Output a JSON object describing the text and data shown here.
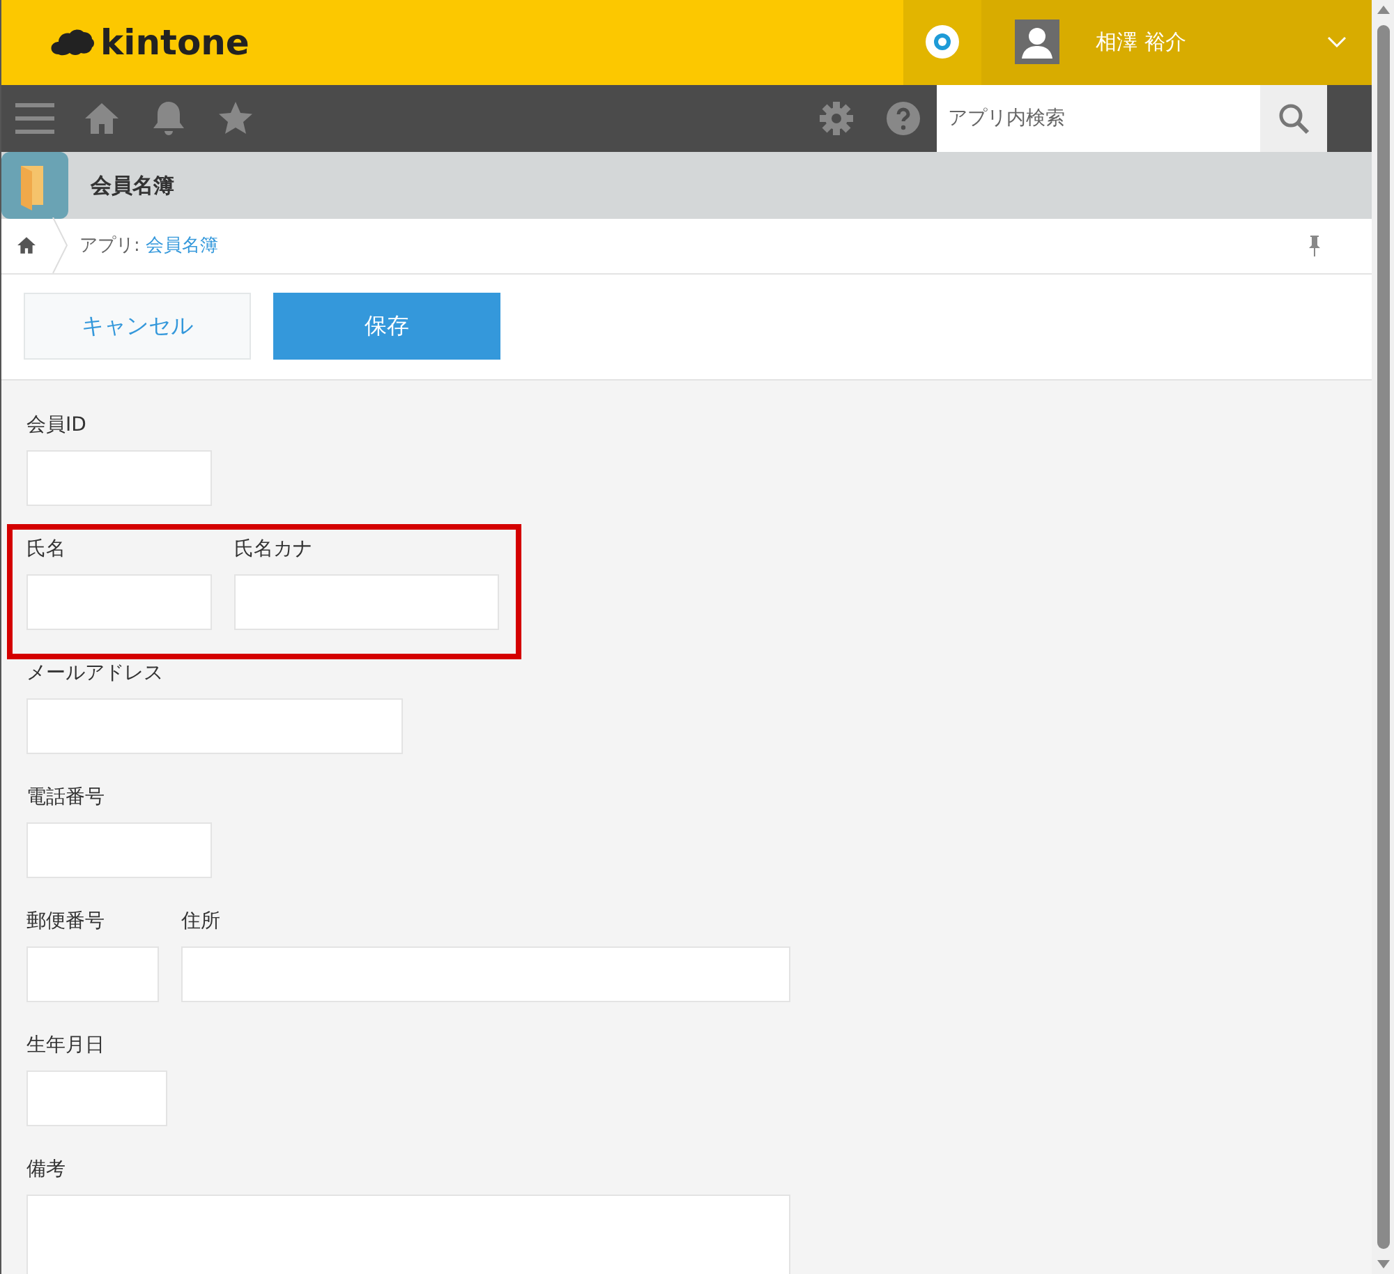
{
  "header": {
    "logo": "kintone",
    "user_name": "相澤 裕介"
  },
  "search": {
    "placeholder": "アプリ内検索"
  },
  "app": {
    "title": "会員名簿"
  },
  "breadcrumb": {
    "prefix": "アプリ:",
    "link": "会員名簿"
  },
  "buttons": [
    {
      "label": "キャンセル",
      "kind": "secondary"
    },
    {
      "label": "保存",
      "kind": "primary"
    }
  ],
  "form_rows": [
    {
      "highlighted": false,
      "fields": [
        {
          "label": "会員ID",
          "kind": "short"
        }
      ]
    },
    {
      "highlighted": true,
      "fields": [
        {
          "label": "氏名",
          "kind": "short"
        },
        {
          "label": "氏名カナ",
          "kind": "medium"
        }
      ]
    },
    {
      "highlighted": false,
      "fields": [
        {
          "label": "メールアドレス",
          "kind": "wide"
        }
      ]
    },
    {
      "highlighted": false,
      "fields": [
        {
          "label": "電話番号",
          "kind": "short"
        }
      ]
    },
    {
      "highlighted": false,
      "fields": [
        {
          "label": "郵便番号",
          "kind": "tiny"
        },
        {
          "label": "住所",
          "kind": "long"
        }
      ]
    },
    {
      "highlighted": false,
      "fields": [
        {
          "label": "生年月日",
          "kind": "date"
        }
      ]
    },
    {
      "highlighted": false,
      "fields": [
        {
          "label": "備考",
          "kind": "multiline"
        }
      ]
    }
  ]
}
